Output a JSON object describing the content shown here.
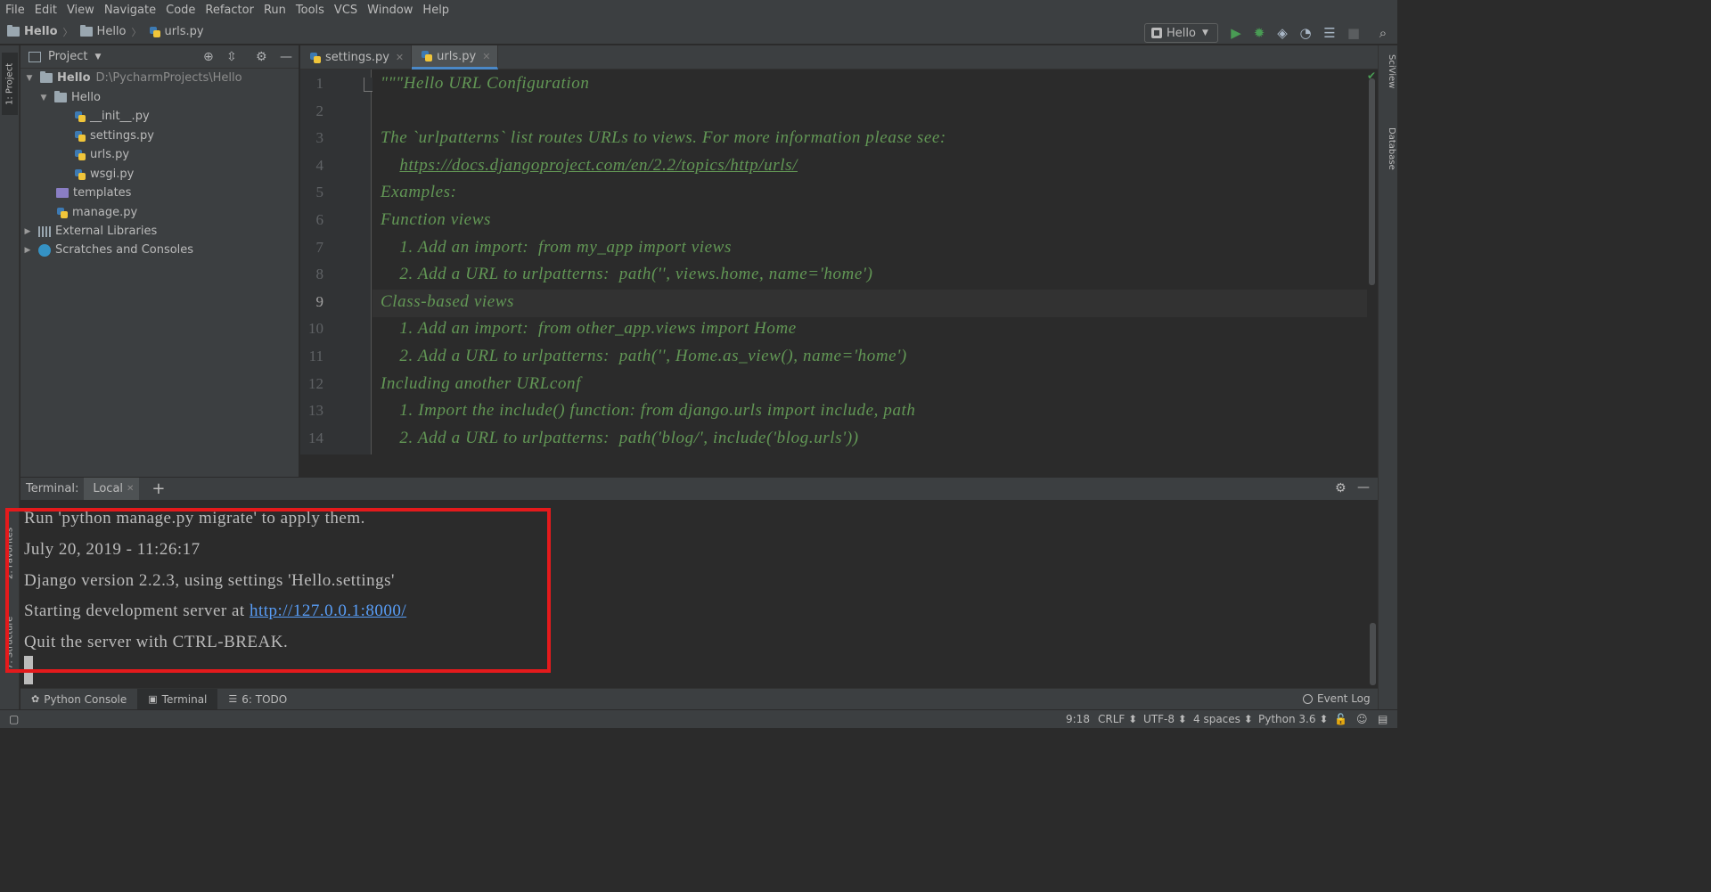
{
  "menu": [
    "File",
    "Edit",
    "View",
    "Navigate",
    "Code",
    "Refactor",
    "Run",
    "Tools",
    "VCS",
    "Window",
    "Help"
  ],
  "breadcrumb": [
    "Hello",
    "Hello",
    "urls.py"
  ],
  "run_config": "Hello",
  "left_stripe": {
    "project": "1: Project",
    "favorites": "2: Favorites",
    "structure": "7: Structure"
  },
  "right_stripe": {
    "sciview": "SciView",
    "database": "Database"
  },
  "project_panel": {
    "title": "Project",
    "tree": [
      {
        "label": "Hello",
        "path": "D:\\PycharmProjects\\Hello",
        "kind": "folder",
        "expanded": true
      },
      {
        "label": "Hello",
        "kind": "folder",
        "expanded": true
      },
      {
        "label": "__init__.py",
        "kind": "py"
      },
      {
        "label": "settings.py",
        "kind": "py"
      },
      {
        "label": "urls.py",
        "kind": "py"
      },
      {
        "label": "wsgi.py",
        "kind": "py"
      },
      {
        "label": "templates",
        "kind": "template-folder"
      },
      {
        "label": "manage.py",
        "kind": "py"
      },
      {
        "label": "External Libraries",
        "kind": "library",
        "expanded": false
      },
      {
        "label": "Scratches and Consoles",
        "kind": "scratches",
        "expanded": false
      }
    ]
  },
  "editor": {
    "tabs": [
      {
        "label": "settings.py",
        "active": false
      },
      {
        "label": "urls.py",
        "active": true
      }
    ],
    "current_line": 9,
    "lines": [
      {
        "n": "1",
        "text": "\"\"\"Hello URL Configuration"
      },
      {
        "n": "2",
        "text": ""
      },
      {
        "n": "3",
        "text": "The `urlpatterns` list routes URLs to views. For more information please see:"
      },
      {
        "n": "4",
        "text": "    https://docs.djangoproject.com/en/2.2/topics/http/urls/"
      },
      {
        "n": "5",
        "text": "Examples:"
      },
      {
        "n": "6",
        "text": "Function views"
      },
      {
        "n": "7",
        "text": "    1. Add an import:  from my_app import views"
      },
      {
        "n": "8",
        "text": "    2. Add a URL to urlpatterns:  path('', views.home, name='home')"
      },
      {
        "n": "9",
        "text": "Class-based views"
      },
      {
        "n": "10",
        "text": "    1. Add an import:  from other_app.views import Home"
      },
      {
        "n": "11",
        "text": "    2. Add a URL to urlpatterns:  path('', Home.as_view(), name='home')"
      },
      {
        "n": "12",
        "text": "Including another URLconf"
      },
      {
        "n": "13",
        "text": "    1. Import the include() function: from django.urls import include, path"
      },
      {
        "n": "14",
        "text": "    2. Add a URL to urlpatterns:  path('blog/', include('blog.urls'))"
      }
    ],
    "link_text": "https://docs.djangoproject.com/en/2.2/topics/http/urls/"
  },
  "terminal": {
    "label": "Terminal:",
    "tab": "Local",
    "lines": [
      "Run 'python manage.py migrate' to apply them.",
      "July 20, 2019 - 11:26:17",
      "Django version 2.2.3, using settings 'Hello.settings'",
      "Starting development server at ",
      "Quit the server with CTRL-BREAK."
    ],
    "server_url": "http://127.0.0.1:8000/"
  },
  "bottom_tabs": [
    {
      "label": "Python Console",
      "active": false,
      "icon": "python-icon"
    },
    {
      "label": "Terminal",
      "active": true,
      "icon": "terminal-icon"
    },
    {
      "label": "6: TODO",
      "active": false,
      "icon": "todo-icon"
    }
  ],
  "event_log": "Event Log",
  "status": {
    "position": "9:18",
    "line_sep": "CRLF",
    "encoding": "UTF-8",
    "indent": "4 spaces",
    "interpreter": "Python 3.6"
  },
  "colors": {
    "docstring": "#629755",
    "link": "#589df6",
    "highlight_box": "#e41a1c",
    "active_tab_underline": "#4a88c7"
  }
}
